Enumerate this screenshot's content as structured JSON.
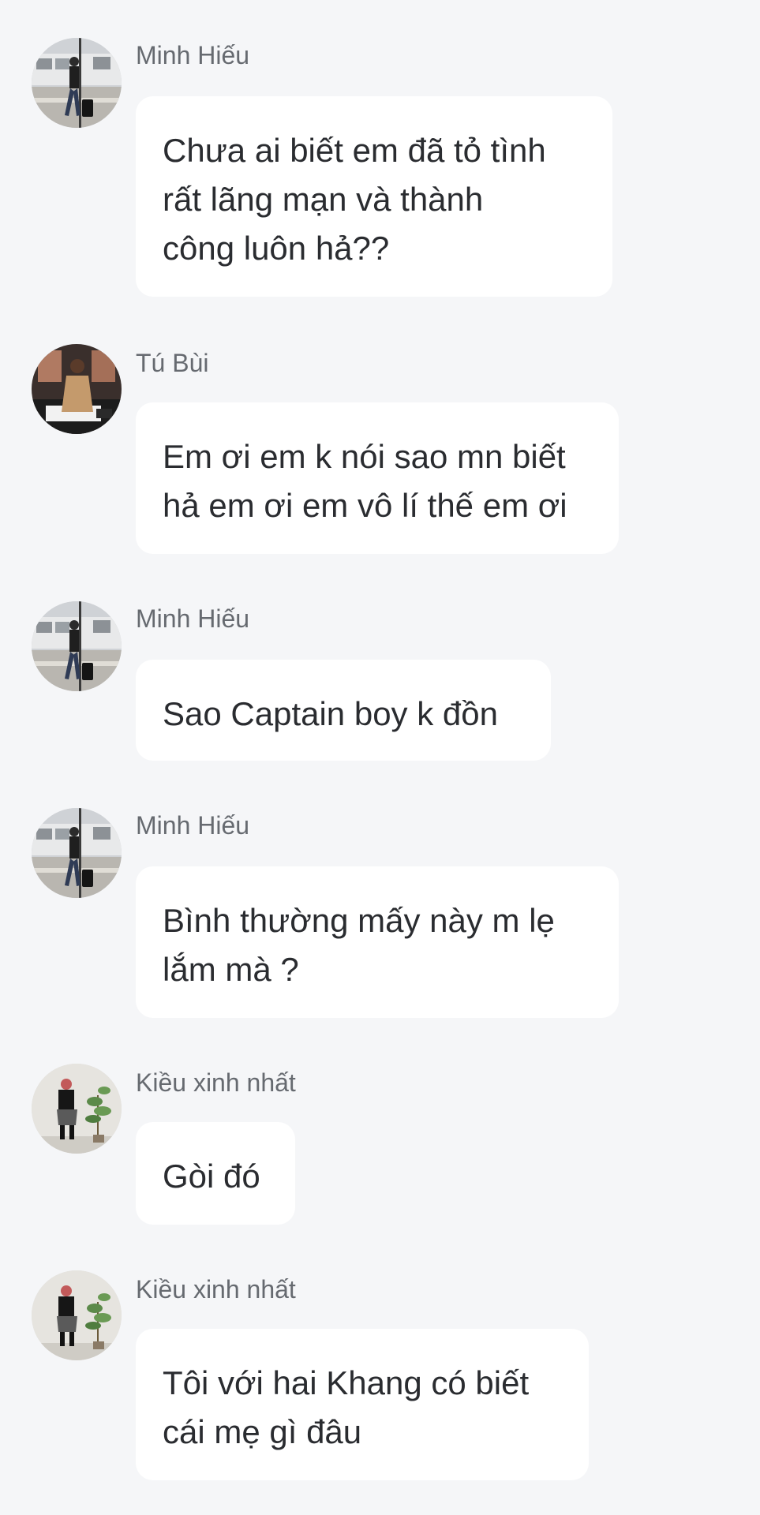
{
  "messages": [
    {
      "sender": "Minh Hiếu",
      "avatar_icon": "street-walker-avatar",
      "text": "Chưa ai biết em đã tỏ tình\nrất lãng mạn và thành\ncông luôn hả??"
    },
    {
      "sender": "Tú Bùi",
      "avatar_icon": "coat-person-avatar",
      "text": "Em ơi em k nói sao mn biết\nhả em ơi em vô lí thế em ơi"
    },
    {
      "sender": "Minh Hiếu",
      "avatar_icon": "street-walker-avatar",
      "text": "Sao Captain boy k đồn"
    },
    {
      "sender": "Minh Hiếu",
      "avatar_icon": "street-walker-avatar",
      "text": "Bình thường mấy này m lẹ\nlắm mà ?"
    },
    {
      "sender": "Kiều xinh nhất",
      "avatar_icon": "plant-pose-avatar",
      "text": "Gòi đó"
    },
    {
      "sender": "Kiều xinh nhất",
      "avatar_icon": "plant-pose-avatar",
      "text": "Tôi với hai Khang có biết\ncái mẹ gì đâu"
    }
  ],
  "colors": {
    "background": "#f5f6f8",
    "bubble": "#ffffff",
    "text": "#2a2c30",
    "sender": "#666a70"
  }
}
